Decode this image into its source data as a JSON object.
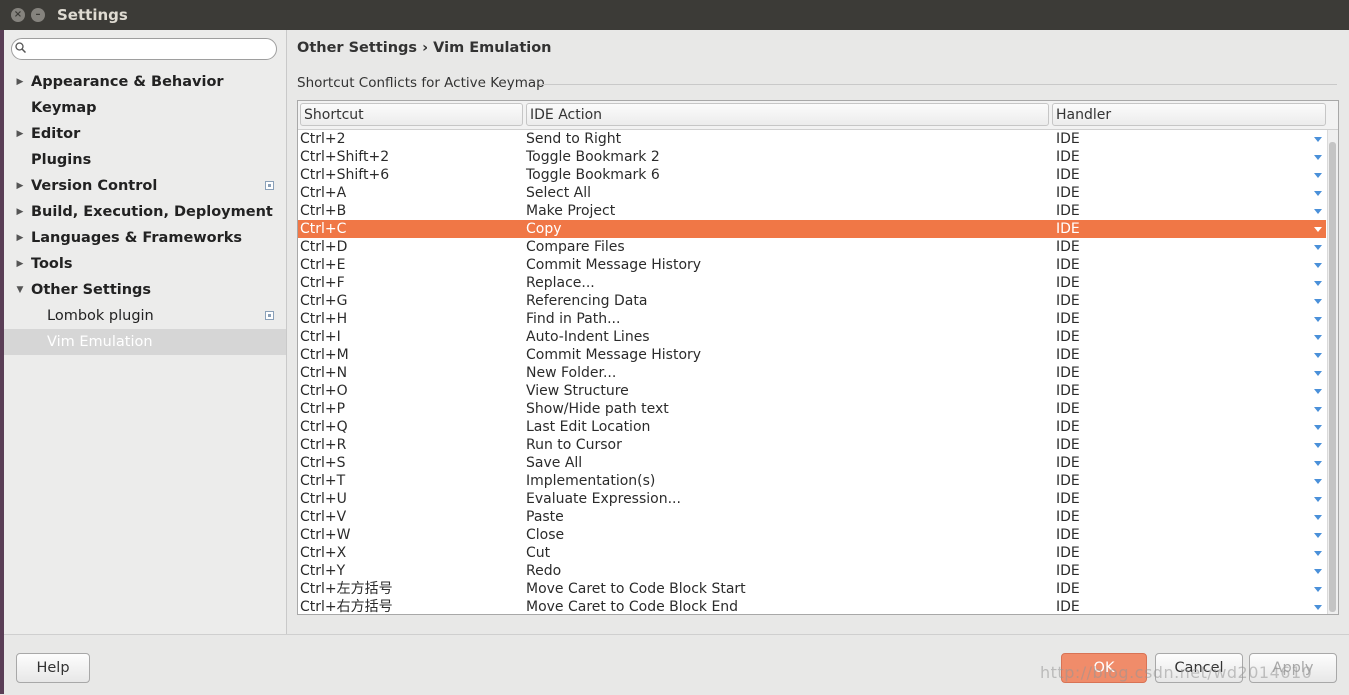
{
  "window": {
    "title": "Settings"
  },
  "search": {
    "placeholder": ""
  },
  "sidebar": {
    "items": [
      {
        "label": "Appearance & Behavior",
        "expandable": true
      },
      {
        "label": "Keymap",
        "expandable": false
      },
      {
        "label": "Editor",
        "expandable": true
      },
      {
        "label": "Plugins",
        "expandable": false
      },
      {
        "label": "Version Control",
        "expandable": true,
        "project_icon": true
      },
      {
        "label": "Build, Execution, Deployment",
        "expandable": true
      },
      {
        "label": "Languages & Frameworks",
        "expandable": true
      },
      {
        "label": "Tools",
        "expandable": true
      },
      {
        "label": "Other Settings",
        "expanded": true
      },
      {
        "label": "Lombok plugin",
        "child": true,
        "project_icon": true
      },
      {
        "label": "Vim Emulation",
        "child": true,
        "selected": true
      }
    ]
  },
  "main": {
    "breadcrumb": "Other Settings › Vim Emulation",
    "section_title": "Shortcut Conflicts for Active Keymap",
    "table": {
      "headers": [
        "Shortcut",
        "IDE Action",
        "Handler"
      ],
      "rows": [
        [
          "Ctrl+2",
          "Send to Right",
          "IDE"
        ],
        [
          "Ctrl+Shift+2",
          "Toggle Bookmark 2",
          "IDE"
        ],
        [
          "Ctrl+Shift+6",
          "Toggle Bookmark 6",
          "IDE"
        ],
        [
          "Ctrl+A",
          "Select All",
          "IDE"
        ],
        [
          "Ctrl+B",
          "Make Project",
          "IDE"
        ],
        [
          "Ctrl+C",
          "Copy",
          "IDE"
        ],
        [
          "Ctrl+D",
          "Compare Files",
          "IDE"
        ],
        [
          "Ctrl+E",
          "Commit Message History",
          "IDE"
        ],
        [
          "Ctrl+F",
          "Replace...",
          "IDE"
        ],
        [
          "Ctrl+G",
          "Referencing Data",
          "IDE"
        ],
        [
          "Ctrl+H",
          "Find in Path...",
          "IDE"
        ],
        [
          "Ctrl+I",
          "Auto-Indent Lines",
          "IDE"
        ],
        [
          "Ctrl+M",
          "Commit Message History",
          "IDE"
        ],
        [
          "Ctrl+N",
          "New Folder...",
          "IDE"
        ],
        [
          "Ctrl+O",
          "View Structure",
          "IDE"
        ],
        [
          "Ctrl+P",
          "Show/Hide path text",
          "IDE"
        ],
        [
          "Ctrl+Q",
          "Last Edit Location",
          "IDE"
        ],
        [
          "Ctrl+R",
          "Run to Cursor",
          "IDE"
        ],
        [
          "Ctrl+S",
          "Save All",
          "IDE"
        ],
        [
          "Ctrl+T",
          "Implementation(s)",
          "IDE"
        ],
        [
          "Ctrl+U",
          "Evaluate Expression...",
          "IDE"
        ],
        [
          "Ctrl+V",
          "Paste",
          "IDE"
        ],
        [
          "Ctrl+W",
          "Close",
          "IDE"
        ],
        [
          "Ctrl+X",
          "Cut",
          "IDE"
        ],
        [
          "Ctrl+Y",
          "Redo",
          "IDE"
        ],
        [
          "Ctrl+左方括号",
          "Move Caret to Code Block Start",
          "IDE"
        ],
        [
          "Ctrl+右方括号",
          "Move Caret to Code Block End",
          "IDE"
        ]
      ],
      "selected_index": 5
    }
  },
  "buttons": {
    "help": "Help",
    "ok": "OK",
    "cancel": "Cancel",
    "apply": "Apply"
  },
  "watermark": "http://blog.csdn.net/wd2014610",
  "colors": {
    "selection": "#f07746",
    "ok_button": "#f08c6a",
    "titlebar": "#3c3b37"
  },
  "icons": {
    "search": "search-icon",
    "close": "close-icon",
    "minimize": "minimize-icon",
    "dropdown": "dropdown-arrow-icon"
  }
}
